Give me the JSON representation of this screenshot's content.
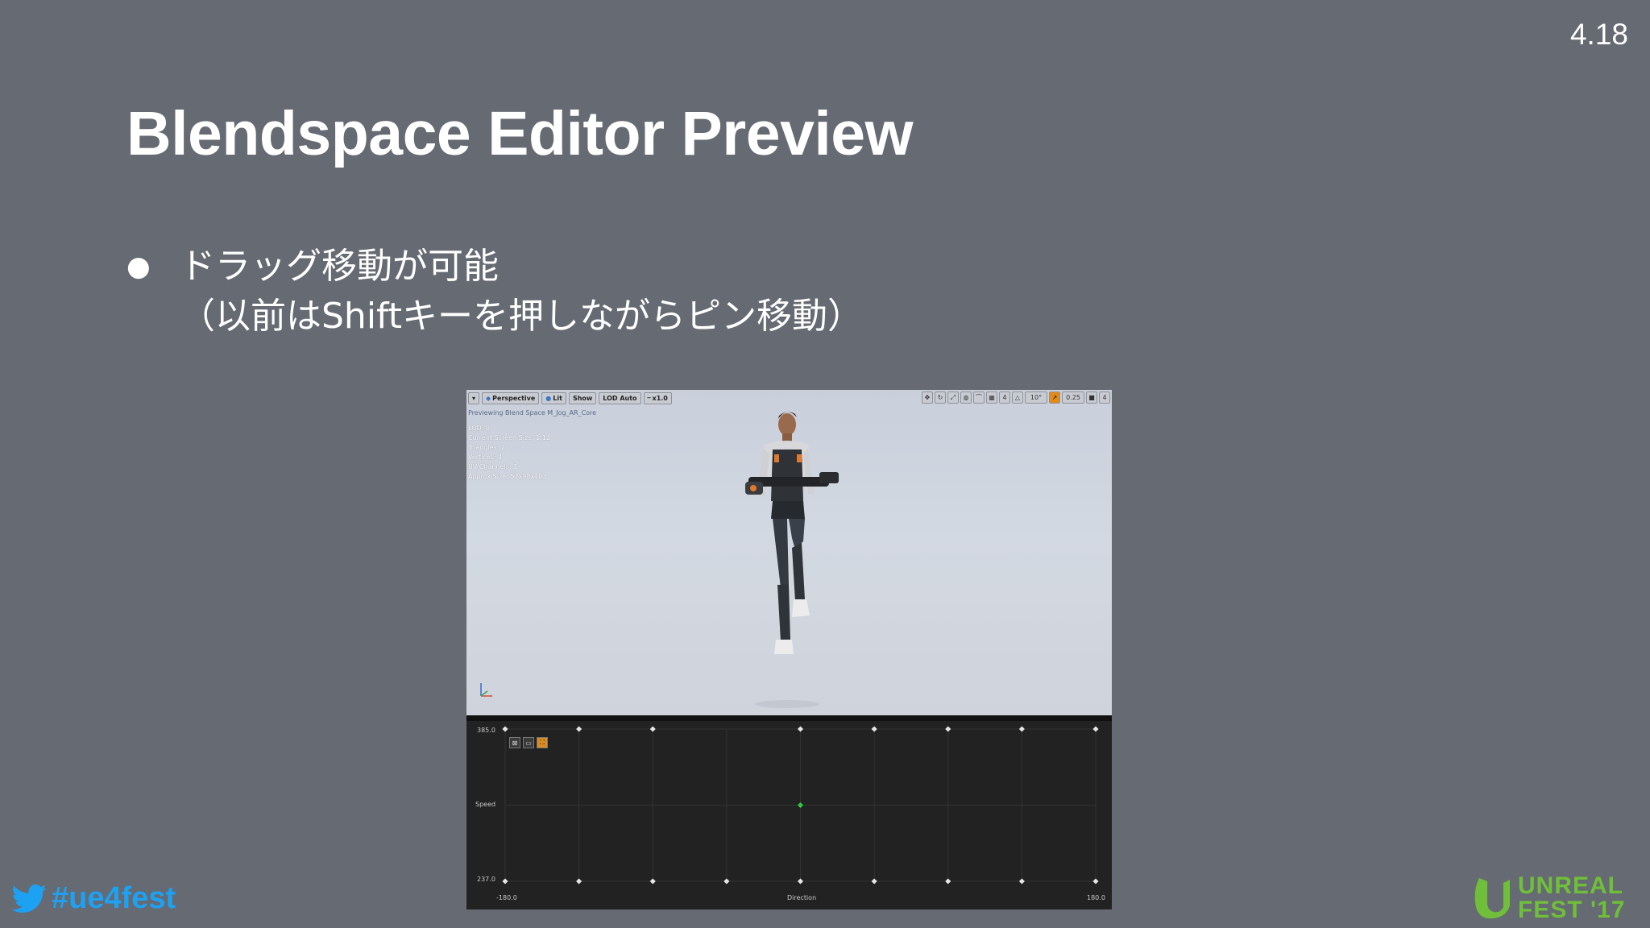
{
  "slide": {
    "version": "4.18",
    "title": "Blendspace Editor Preview",
    "bullet_line1": "ドラッグ移動が可能",
    "bullet_line2": "（以前はShiftキーを押しながらピン移動）"
  },
  "viewport": {
    "toolbar": {
      "menu_icon": "▾",
      "perspective_label": "Perspective",
      "lit_label": "Lit",
      "show_label": "Show",
      "lod_label": "LOD Auto",
      "speed_label": "x1.0",
      "right_icons": [
        "translate-icon",
        "rotate-icon",
        "scale-icon",
        "world-icon",
        "surface-snap-icon",
        "grid-snap-icon"
      ],
      "grid_value": "4",
      "rotation_snap_value": "10°",
      "scale_snap_value": "0.25",
      "camera_speed_value": "4"
    },
    "caption": "Previewing Blend Space M_Jog_AR_Core",
    "stats": [
      "LOD: 0",
      "Current Screen Size: 1.12",
      "Triangles: 2",
      "Vertices: 4",
      "UV Channels: 1",
      "Approx Size: 52x98x103"
    ]
  },
  "blendspace": {
    "y_axis_label": "Speed",
    "y_max_label": "385.0",
    "y_min_label": "237.0",
    "x_axis_label": "Direction",
    "x_min_label": "-180.0",
    "x_max_label": "180.0",
    "preview_point": {
      "direction": 0,
      "speed": 311
    },
    "colors": {
      "sample": "#e6e6e6",
      "preview": "#2ecc40"
    }
  },
  "footer": {
    "hashtag": "#ue4fest",
    "logo_line1": "UNREAL",
    "logo_line2": "FEST '17"
  }
}
